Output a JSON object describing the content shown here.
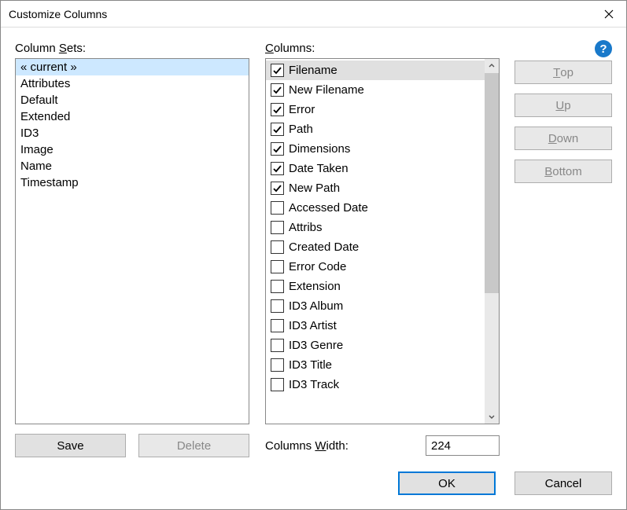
{
  "title": "Customize Columns",
  "labels": {
    "column_sets": "Column Sets:",
    "columns": "Columns:",
    "columns_width": "Columns Width:"
  },
  "column_sets": {
    "items": [
      {
        "label": "« current »",
        "selected": true
      },
      {
        "label": "Attributes",
        "selected": false
      },
      {
        "label": "Default",
        "selected": false
      },
      {
        "label": "Extended",
        "selected": false
      },
      {
        "label": "ID3",
        "selected": false
      },
      {
        "label": "Image",
        "selected": false
      },
      {
        "label": "Name",
        "selected": false
      },
      {
        "label": "Timestamp",
        "selected": false
      }
    ]
  },
  "columns": {
    "items": [
      {
        "label": "Filename",
        "checked": true,
        "selected": true
      },
      {
        "label": "New Filename",
        "checked": true,
        "selected": false
      },
      {
        "label": "Error",
        "checked": true,
        "selected": false
      },
      {
        "label": "Path",
        "checked": true,
        "selected": false
      },
      {
        "label": "Dimensions",
        "checked": true,
        "selected": false
      },
      {
        "label": "Date Taken",
        "checked": true,
        "selected": false
      },
      {
        "label": "New Path",
        "checked": true,
        "selected": false
      },
      {
        "label": "Accessed Date",
        "checked": false,
        "selected": false
      },
      {
        "label": "Attribs",
        "checked": false,
        "selected": false
      },
      {
        "label": "Created Date",
        "checked": false,
        "selected": false
      },
      {
        "label": "Error Code",
        "checked": false,
        "selected": false
      },
      {
        "label": "Extension",
        "checked": false,
        "selected": false
      },
      {
        "label": "ID3 Album",
        "checked": false,
        "selected": false
      },
      {
        "label": "ID3 Artist",
        "checked": false,
        "selected": false
      },
      {
        "label": "ID3 Genre",
        "checked": false,
        "selected": false
      },
      {
        "label": "ID3 Title",
        "checked": false,
        "selected": false
      },
      {
        "label": "ID3 Track",
        "checked": false,
        "selected": false
      }
    ]
  },
  "reorder_buttons": {
    "top": "Top",
    "up": "Up",
    "down": "Down",
    "bottom": "Bottom"
  },
  "set_buttons": {
    "save": "Save",
    "delete": "Delete"
  },
  "columns_width_value": "224",
  "dialog_buttons": {
    "ok": "OK",
    "cancel": "Cancel"
  },
  "help_glyph": "?"
}
